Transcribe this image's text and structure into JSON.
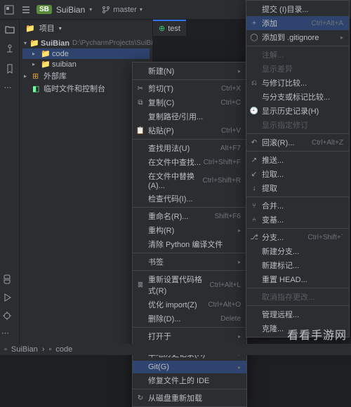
{
  "titlebar": {
    "project": "SuiBian",
    "badge": "SB",
    "branch": "master"
  },
  "panel": {
    "title": "项目"
  },
  "tree": {
    "root": "SuiBian",
    "root_path": "D:\\PycharmProjects\\SuiBian",
    "children": [
      "code",
      "suibian"
    ],
    "ext_lib": "外部库",
    "scratch": "临时文件和控制台"
  },
  "tab": {
    "name": "test"
  },
  "ctx": [
    {
      "t": "item",
      "label": "新建(N)",
      "arrow": true
    },
    {
      "t": "sep"
    },
    {
      "t": "item",
      "label": "剪切(T)",
      "sc": "Ctrl+X",
      "ico": "✂"
    },
    {
      "t": "item",
      "label": "复制(C)",
      "sc": "Ctrl+C",
      "ico": "⧉"
    },
    {
      "t": "item",
      "label": "复制路径/引用...",
      "arrow": false
    },
    {
      "t": "item",
      "label": "粘贴(P)",
      "sc": "Ctrl+V",
      "ico": "📋"
    },
    {
      "t": "sep"
    },
    {
      "t": "item",
      "label": "查找用法(U)",
      "sc": "Alt+F7"
    },
    {
      "t": "item",
      "label": "在文件中查找...",
      "sc": "Ctrl+Shift+F"
    },
    {
      "t": "item",
      "label": "在文件中替换(A)...",
      "sc": "Ctrl+Shift+R"
    },
    {
      "t": "item",
      "label": "检查代码(I)...",
      "arrow": false
    },
    {
      "t": "sep"
    },
    {
      "t": "item",
      "label": "重命名(R)...",
      "sc": "Shift+F6"
    },
    {
      "t": "item",
      "label": "重构(R)",
      "arrow": true
    },
    {
      "t": "item",
      "label": "清除 Python 编译文件"
    },
    {
      "t": "sep"
    },
    {
      "t": "item",
      "label": "书签",
      "arrow": true
    },
    {
      "t": "sep"
    },
    {
      "t": "item",
      "label": "重新设置代码格式(R)",
      "sc": "Ctrl+Alt+L",
      "ico": "≣"
    },
    {
      "t": "item",
      "label": "优化 import(Z)",
      "sc": "Ctrl+Alt+O"
    },
    {
      "t": "item",
      "label": "删除(D)...",
      "sc": "Delete"
    },
    {
      "t": "sep"
    },
    {
      "t": "item",
      "label": "打开于",
      "arrow": true
    },
    {
      "t": "sep"
    },
    {
      "t": "item",
      "label": "本地历史记录(H)",
      "arrow": true
    },
    {
      "t": "item",
      "label": "Git(G)",
      "arrow": true,
      "hov": true
    },
    {
      "t": "item",
      "label": "修复文件上的 IDE"
    },
    {
      "t": "sep"
    },
    {
      "t": "item",
      "label": "从磁盘重新加载",
      "ico": "↻"
    }
  ],
  "sub": [
    {
      "t": "item",
      "label": "提交 (I)目录..."
    },
    {
      "t": "item",
      "label": "添加",
      "sc": "Ctrl+Alt+A",
      "ico": "+",
      "hov": true
    },
    {
      "t": "item",
      "label": "添加到 .gitignore",
      "arrow": true,
      "ico": "◯"
    },
    {
      "t": "sep"
    },
    {
      "t": "item",
      "label": "注解...",
      "dim": true
    },
    {
      "t": "item",
      "label": "显示差异",
      "dim": true
    },
    {
      "t": "item",
      "label": "与修订比较...",
      "ico": "⎌"
    },
    {
      "t": "item",
      "label": "与分支或标记比较..."
    },
    {
      "t": "item",
      "label": "显示历史记录(H)",
      "ico": "🕘"
    },
    {
      "t": "item",
      "label": "显示指定修订",
      "dim": true
    },
    {
      "t": "sep"
    },
    {
      "t": "item",
      "label": "回滚(R)...",
      "sc": "Ctrl+Alt+Z",
      "ico": "↶"
    },
    {
      "t": "sep"
    },
    {
      "t": "item",
      "label": "推送...",
      "ico": "↗"
    },
    {
      "t": "item",
      "label": "拉取...",
      "ico": "↙"
    },
    {
      "t": "item",
      "label": "提取",
      "ico": "↓"
    },
    {
      "t": "sep"
    },
    {
      "t": "item",
      "label": "合并...",
      "ico": "⑂"
    },
    {
      "t": "item",
      "label": "变基...",
      "ico": "⑃"
    },
    {
      "t": "sep"
    },
    {
      "t": "item",
      "label": "分支...",
      "sc": "Ctrl+Shift+`",
      "ico": "⎇"
    },
    {
      "t": "item",
      "label": "新建分支..."
    },
    {
      "t": "item",
      "label": "新建标记..."
    },
    {
      "t": "item",
      "label": "重置 HEAD..."
    },
    {
      "t": "sep"
    },
    {
      "t": "item",
      "label": "取消指存更改...",
      "dim": true
    },
    {
      "t": "sep"
    },
    {
      "t": "item",
      "label": "管理远程..."
    },
    {
      "t": "item",
      "label": "克隆..."
    }
  ],
  "status": {
    "bc1": "SuiBian",
    "bc2": "code"
  },
  "watermark": "看看手游网"
}
